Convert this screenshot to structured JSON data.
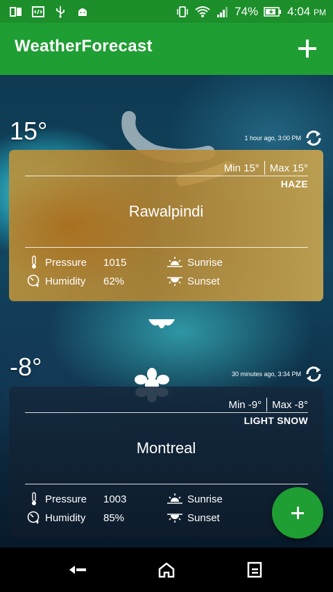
{
  "status_bar": {
    "battery": "74%",
    "time": "4:04",
    "ampm": "PM"
  },
  "app_bar": {
    "title": "WeatherForecast"
  },
  "cards": [
    {
      "temp": "15°",
      "updated": "1 hour ago, 3:00 PM",
      "min": "Min 15°",
      "max": "Max 15°",
      "condition": "HAZE",
      "city": "Rawalpindi",
      "pressure_label": "Pressure",
      "pressure": "1015",
      "humidity_label": "Humidity",
      "humidity": "62%",
      "sunrise_label": "Sunrise",
      "sunset_label": "Sunset"
    },
    {
      "temp": "-8°",
      "updated": "30 minutes ago, 3:34 PM",
      "min": "Min -9°",
      "max": "Max -8°",
      "condition": "LIGHT SNOW",
      "city": "Montreal",
      "pressure_label": "Pressure",
      "pressure": "1003",
      "humidity_label": "Humidity",
      "humidity": "85%",
      "sunrise_label": "Sunrise",
      "sunset_label": "Sunset"
    }
  ],
  "colors": {
    "primary": "#1f9e33",
    "status": "#1c8f2a"
  }
}
